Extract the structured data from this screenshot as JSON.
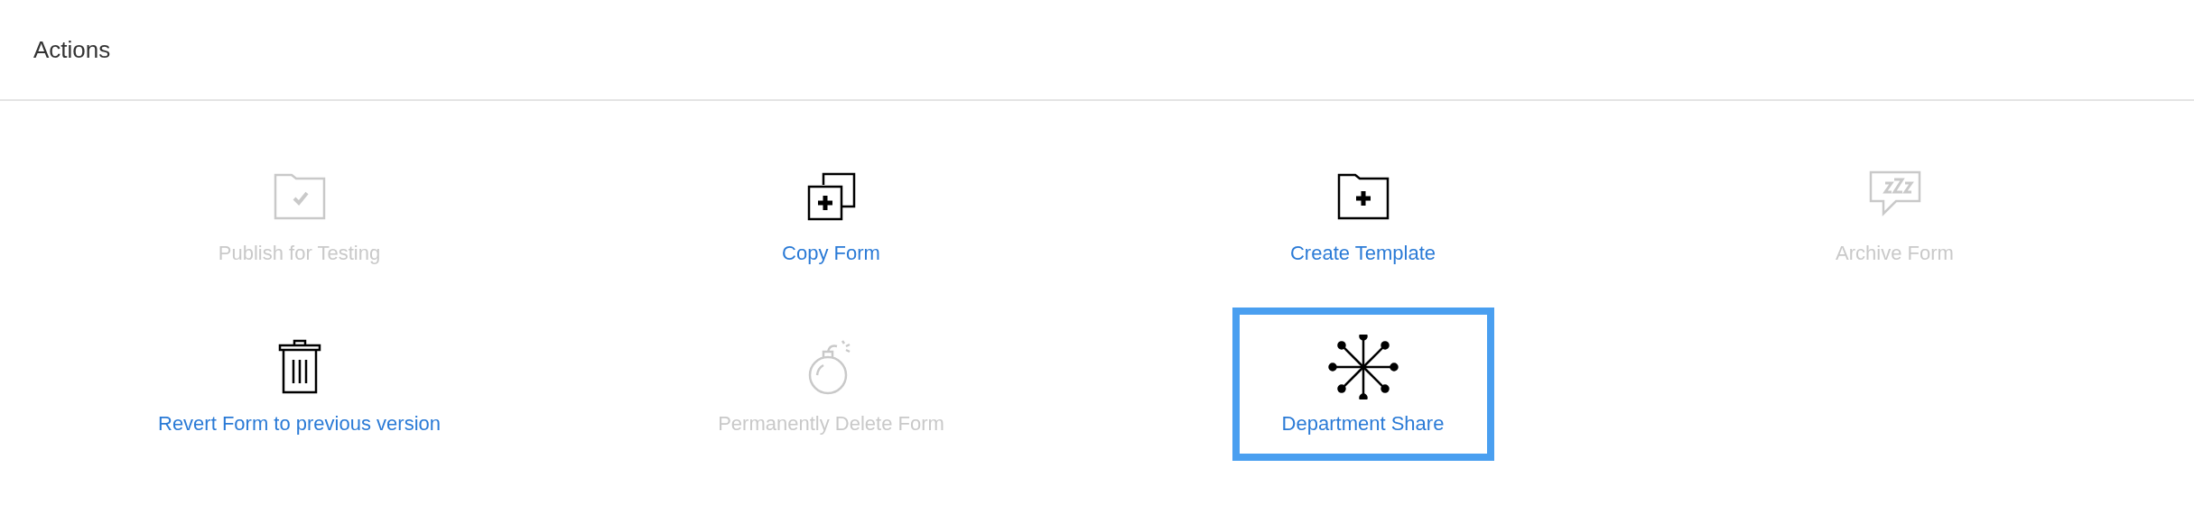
{
  "header": {
    "title": "Actions"
  },
  "actions": [
    {
      "kind": "publish",
      "label": "Publish for Testing",
      "disabled": true,
      "selected": false
    },
    {
      "kind": "copy",
      "label": "Copy Form",
      "disabled": false,
      "selected": false
    },
    {
      "kind": "template",
      "label": "Create Template",
      "disabled": false,
      "selected": false
    },
    {
      "kind": "archive",
      "label": "Archive Form",
      "disabled": true,
      "selected": false
    },
    {
      "kind": "revert",
      "label": "Revert Form to previous version",
      "disabled": false,
      "selected": false
    },
    {
      "kind": "delete",
      "label": "Permanently Delete Form",
      "disabled": true,
      "selected": false
    },
    {
      "kind": "share",
      "label": "Department Share",
      "disabled": false,
      "selected": true
    }
  ]
}
